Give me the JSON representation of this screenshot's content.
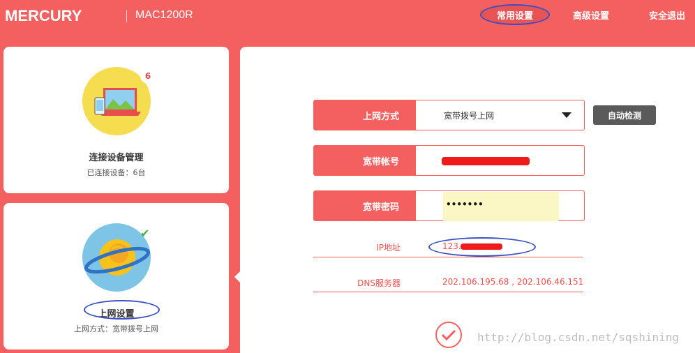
{
  "header": {
    "brand": "MERCURY",
    "model": "MAC1200R",
    "nav": [
      {
        "label": "常用设置"
      },
      {
        "label": "高级设置"
      },
      {
        "label": "安全退出"
      }
    ]
  },
  "sidebar": {
    "devices": {
      "badge": "6",
      "title": "连接设备管理",
      "subtitle": "已连接设备：6台"
    },
    "internet": {
      "title": "上网设置",
      "subtitle": "上网方式：宽带拨号上网"
    }
  },
  "form": {
    "mode": {
      "label": "上网方式",
      "value": "宽带拨号上网"
    },
    "detect_button": "自动检测",
    "account": {
      "label": "宽带帐号"
    },
    "password": {
      "label": "宽带密码",
      "value": "•••••••"
    },
    "ip": {
      "label": "IP地址",
      "value": "123."
    },
    "dns": {
      "label": "DNS服务器",
      "value": "202.106.195.68 , 202.106.46.151"
    }
  },
  "watermark": "http://blog.csdn.net/sqshining",
  "colors": {
    "accent": "#f46060",
    "annotation": "#3b4fc4",
    "button": "#5a5a5a"
  }
}
